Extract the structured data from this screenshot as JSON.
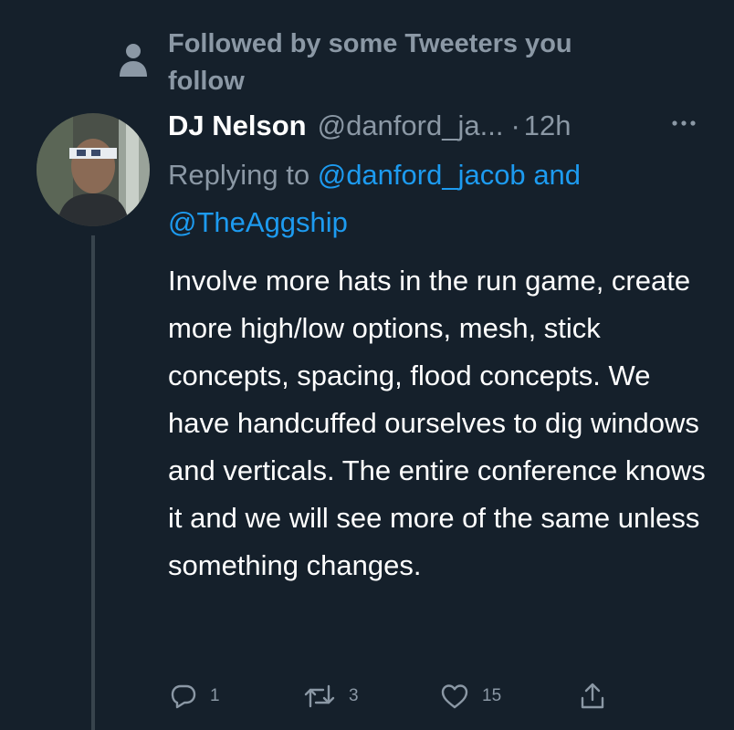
{
  "social_context": {
    "text": "Followed by some Tweeters you follow",
    "icon": "person-icon"
  },
  "tweet": {
    "display_name": "DJ Nelson",
    "handle": "@danford_ja...",
    "separator": "·",
    "time": "12h",
    "replying_prefix": "Replying to",
    "reply_mention_1": "@danford_jacob",
    "reply_and": "and",
    "reply_mention_2": "@TheAggship",
    "body": "Involve more hats in the run game, create more high/low options, mesh, stick concepts, spacing, flood concepts. We have handcuffed ourselves to dig windows and verticals. The entire conference knows it and we will see more of the same unless something changes."
  },
  "actions": {
    "reply_count": "1",
    "retweet_count": "3",
    "like_count": "15"
  },
  "colors": {
    "background": "#15202b",
    "secondary_text": "#8b98a5",
    "accent": "#1d9bf0",
    "thread_line": "#38444d"
  }
}
